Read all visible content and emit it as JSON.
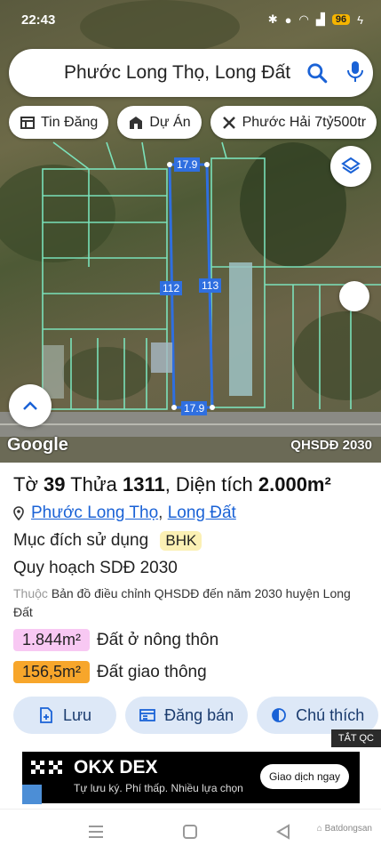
{
  "status_bar": {
    "time": "22:43",
    "battery": "96"
  },
  "search": {
    "query": "Phước Long Thọ, Long Đất",
    "icon": "search-icon",
    "mic_icon": "mic-icon"
  },
  "chips": [
    {
      "label": "Tin Đăng",
      "icon": "listing-icon"
    },
    {
      "label": "Dự Án",
      "icon": "building-icon"
    },
    {
      "label": "Phước Hải 7tỷ500tr",
      "icon": "tools-icon"
    }
  ],
  "map": {
    "dims": {
      "top": "17.9",
      "left": "112",
      "right": "113",
      "bottom": "17.9"
    },
    "google_label": "Google",
    "layer_label": "QHSDĐ 2030"
  },
  "parcel": {
    "to_label": "Tờ",
    "to_value": "39",
    "thua_label": "Thửa",
    "thua_value": "1311",
    "area_label": ", Diện tích",
    "area_value": "2.000m²"
  },
  "location": {
    "ward": "Phước Long Thọ",
    "separator": ",",
    "district": "Long Đất"
  },
  "purpose": {
    "label": "Mục đích sử dụng",
    "code": "BHK"
  },
  "planning": {
    "label": "Quy hoạch SDĐ 2030"
  },
  "description": {
    "prefix": "Thuộc",
    "text": "Bản đồ điều chỉnh QHSDĐ đến năm 2030 huyện Long Đất"
  },
  "areas": [
    {
      "value": "1.844m²",
      "label": "Đất ở nông thôn",
      "color": "#f8c8f3"
    },
    {
      "value": "156,5m²",
      "label": "Đất giao thông",
      "color": "#f7a62b"
    }
  ],
  "actions": [
    {
      "label": "Lưu",
      "icon": "save-icon"
    },
    {
      "label": "Đăng bán",
      "icon": "post-icon"
    },
    {
      "label": "Chú thích",
      "icon": "legend-icon"
    }
  ],
  "ad": {
    "close_label": "TẮT QC",
    "title": "OKX DEX",
    "subtitle": "Tự lưu ký. Phí thấp. Nhiều lựa chọn",
    "cta": "Giao dịch ngay"
  }
}
